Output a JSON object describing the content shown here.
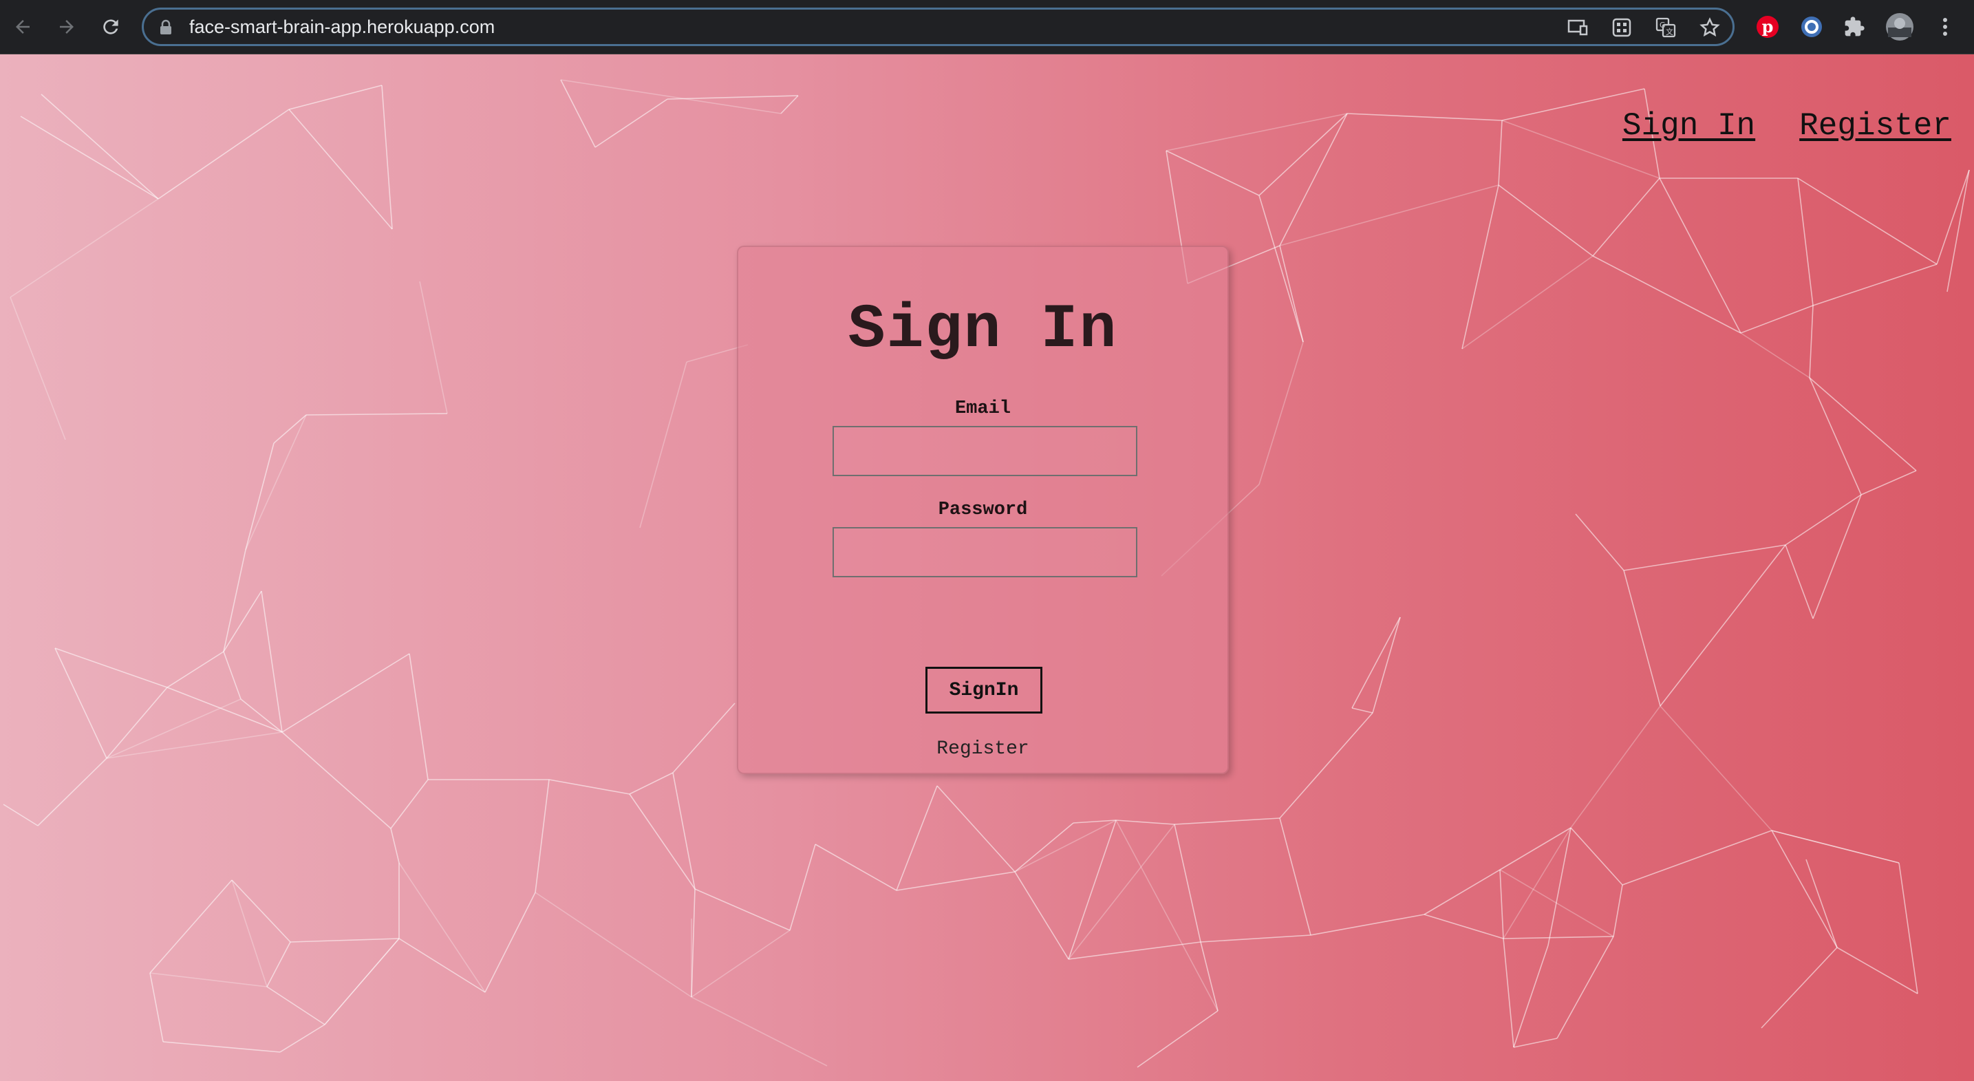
{
  "browser": {
    "url": "face-smart-brain-app.herokuapp.com",
    "icons": [
      "back-icon",
      "forward-icon",
      "reload-icon",
      "lock-icon",
      "cast-icon",
      "apps-icon",
      "translate-icon",
      "star-icon",
      "pinterest-icon",
      "extension-ring-icon",
      "puzzle-icon",
      "avatar",
      "more-icon"
    ]
  },
  "nav": {
    "sign_in": "Sign In",
    "register": "Register"
  },
  "form": {
    "title": "Sign In",
    "email_label": "Email",
    "email_value": "",
    "password_label": "Password",
    "password_value": "",
    "submit_label": "SignIn",
    "register_link": "Register"
  },
  "colors": {
    "gradient_left": "#ebb1bd",
    "gradient_right": "#da5a68",
    "browser_bar": "#202124",
    "text_dark": "#111111"
  }
}
